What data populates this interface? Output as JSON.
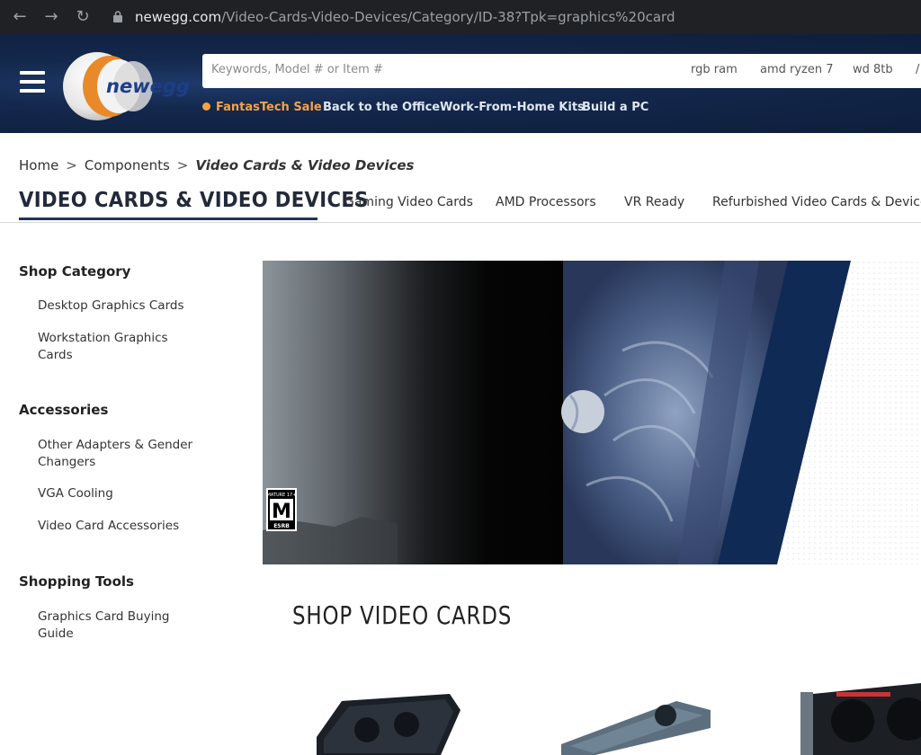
{
  "browser": {
    "url_host": "newegg.com",
    "url_path": "/Video-Cards-Video-Devices/Category/ID-38?Tpk=graphics%20card"
  },
  "header": {
    "logo_text": "newegg",
    "search_placeholder": "Keywords, Model # or Item #",
    "suggestions": [
      "rgb ram",
      "amd ryzen 7",
      "wd 8tb"
    ],
    "promos": [
      "FantasTech Sale",
      "Back to the Office",
      "Work-From-Home Kits",
      "Build a PC"
    ]
  },
  "breadcrumb": {
    "items": [
      "Home",
      "Components"
    ],
    "separator": ">",
    "current": "Video Cards & Video Devices"
  },
  "page": {
    "title": "VIDEO CARDS & VIDEO DEVICES",
    "tabs": [
      "Gaming Video Cards",
      "AMD Processors",
      "VR Ready",
      "Refurbished Video Cards & Devices"
    ]
  },
  "sidebar": {
    "sections": [
      {
        "heading": "Shop Category",
        "items": [
          "Desktop Graphics Cards",
          "Workstation Graphics Cards"
        ]
      },
      {
        "heading": "Accessories",
        "items": [
          "Other Adapters & Gender Changers",
          "VGA Cooling",
          "Video Card Accessories"
        ]
      },
      {
        "heading": "Shopping Tools",
        "items": [
          "Graphics Card Buying Guide"
        ]
      }
    ]
  },
  "banner": {
    "rating_top": "MATURE 17+",
    "rating_letter": "M",
    "rating_bottom": "ESRB"
  },
  "main": {
    "section_title": "SHOP VIDEO CARDS"
  },
  "colors": {
    "header_bg": "#14284d",
    "accent_orange": "#f7a246",
    "banner_navy": "#0f2a55"
  }
}
